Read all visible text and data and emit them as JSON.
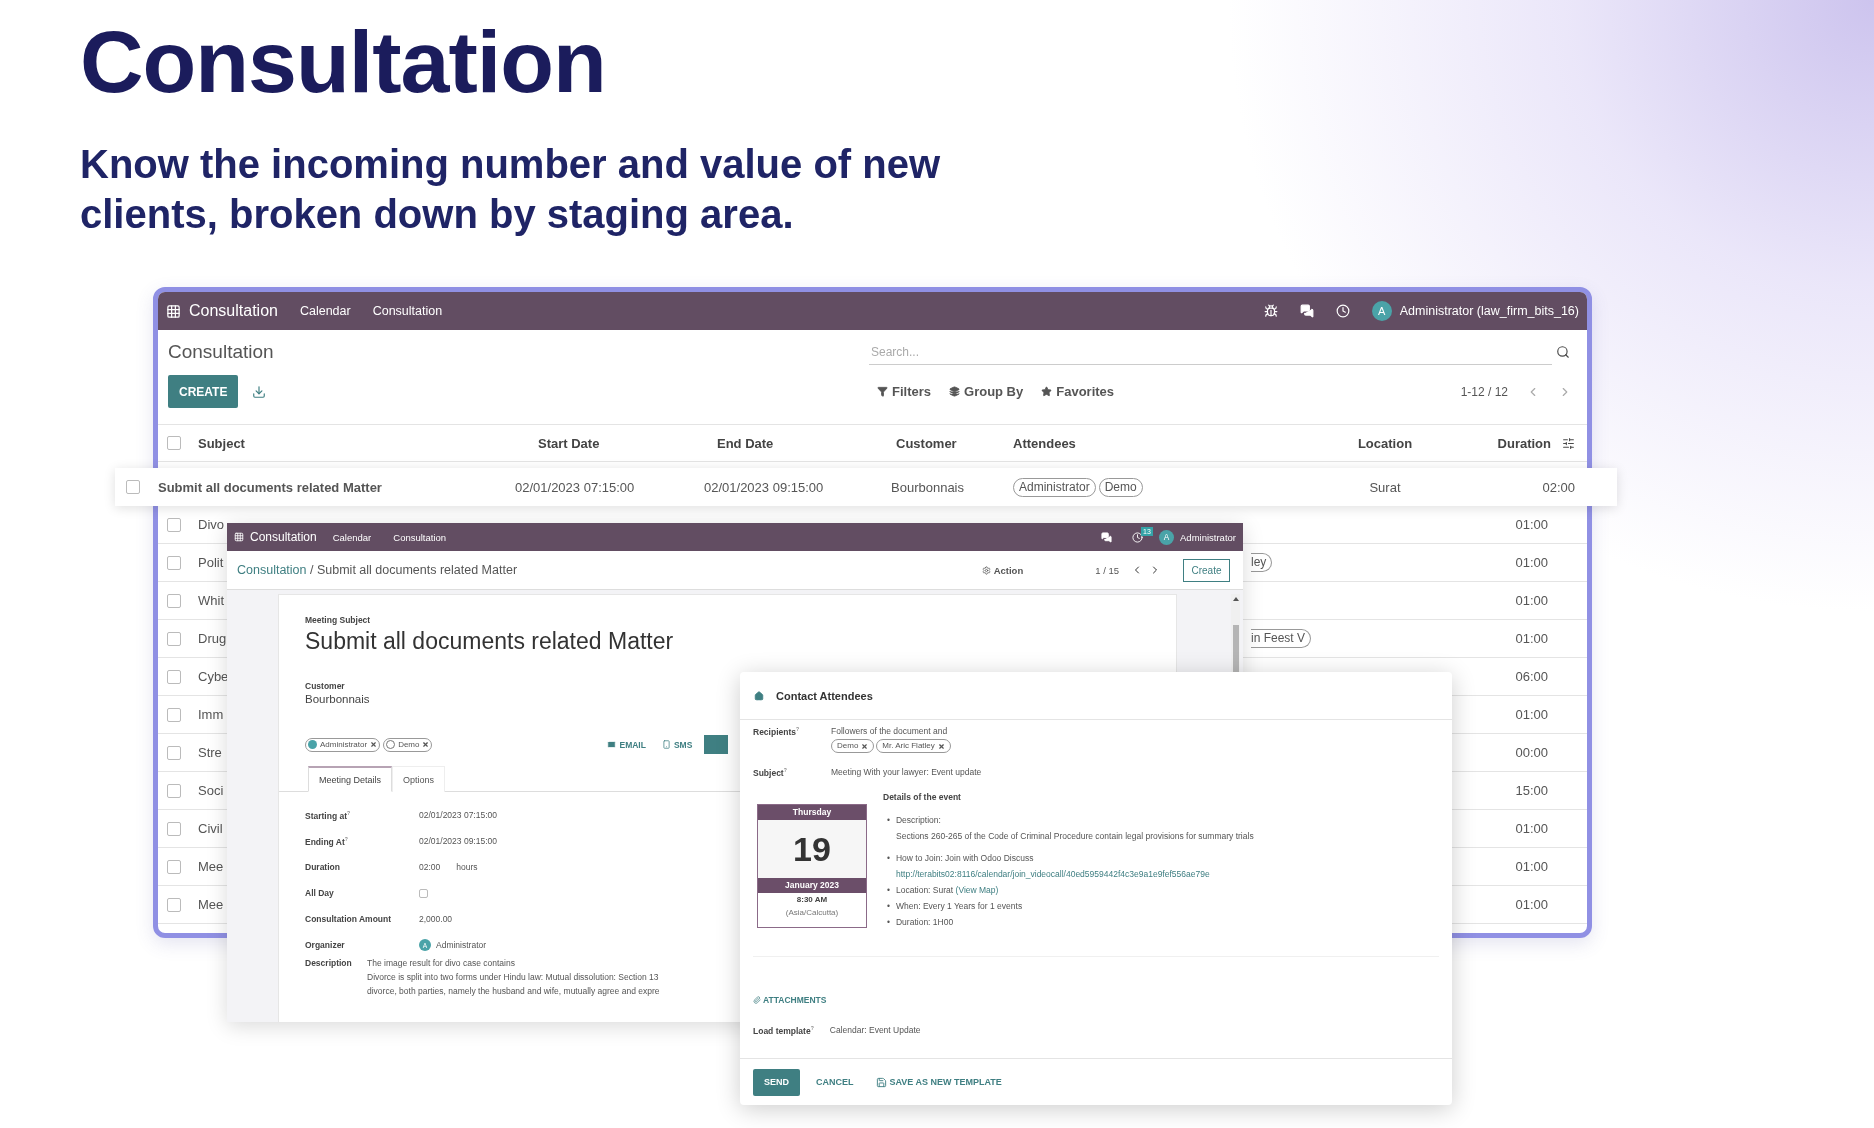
{
  "hero": {
    "title": "Consultation",
    "subtitle": "Know the incoming number and value of new clients, broken down by staging area."
  },
  "list_window": {
    "navbar": {
      "app": "Consultation",
      "menus": [
        "Calendar",
        "Consultation"
      ],
      "avatar": "A",
      "user": "Administrator (law_firm_bits_16)"
    },
    "title": "Consultation",
    "search": {
      "placeholder": "Search..."
    },
    "create": "CREATE",
    "filters": [
      {
        "kind": "filter",
        "label": "Filters"
      },
      {
        "kind": "group",
        "label": "Group By"
      },
      {
        "kind": "favorite",
        "label": "Favorites"
      }
    ],
    "pager": "1-12 / 12",
    "columns": [
      "Subject",
      "Start Date",
      "End Date",
      "Customer",
      "Attendees",
      "Location",
      "Duration"
    ],
    "select_all_checked": false,
    "highlighted_row": {
      "checked": false,
      "subject": "Submit all documents related Matter",
      "start": "02/01/2023 07:15:00",
      "end": "02/01/2023 09:15:00",
      "customer": "Bourbonnais",
      "attendees": [
        "Administrator",
        "Demo"
      ],
      "location": "Surat",
      "duration": "02:00"
    },
    "rows": [
      {
        "checked": false,
        "subject": "Divo",
        "duration": "01:00"
      },
      {
        "checked": false,
        "subject": "Polit",
        "attendee_fragment": "ley",
        "duration": "01:00"
      },
      {
        "checked": false,
        "subject": "Whit",
        "duration": "01:00"
      },
      {
        "checked": false,
        "subject": "Drug",
        "attendee_fragment": "in Feest V",
        "duration": "01:00"
      },
      {
        "checked": false,
        "subject": "Cybe",
        "duration": "06:00"
      },
      {
        "checked": false,
        "subject": "Imm",
        "duration": "01:00"
      },
      {
        "checked": false,
        "subject": "Stre",
        "duration": "00:00"
      },
      {
        "checked": false,
        "subject": "Soci",
        "duration": "15:00"
      },
      {
        "checked": false,
        "subject": "Civil",
        "duration": "01:00"
      },
      {
        "checked": false,
        "subject": "Mee",
        "duration": "01:00"
      },
      {
        "checked": false,
        "subject": "Mee",
        "duration": "01:00"
      }
    ]
  },
  "form_window": {
    "navbar": {
      "app": "Consultation",
      "menus": [
        "Calendar",
        "Consultation"
      ],
      "badge": "13",
      "avatar": "A",
      "user": "Administrator"
    },
    "breadcrumb": {
      "parent": "Consultation",
      "separator": "/",
      "current": "Submit all documents related Matter"
    },
    "action": "Action",
    "pager": "1 / 15",
    "create": "Create",
    "subject_label": "Meeting Subject",
    "subject": "Submit all documents related Matter",
    "customer_label": "Customer",
    "customer": "Bourbonnais",
    "attendees": [
      {
        "name": "Administrator",
        "kind": "user"
      },
      {
        "name": "Demo",
        "kind": "guest"
      }
    ],
    "actions": [
      {
        "kind": "email",
        "label": "EMAIL"
      },
      {
        "kind": "sms",
        "label": "SMS"
      }
    ],
    "tabs": [
      {
        "label": "Meeting Details",
        "selected": true
      },
      {
        "label": "Options",
        "selected": false
      }
    ],
    "fields": [
      {
        "kind": "text",
        "label": "Starting at$^{?}$",
        "value": "02/01/2023 07:15:00"
      },
      {
        "kind": "text",
        "label": "Ending At$^{?}$",
        "value": "02/01/2023 09:15:00"
      },
      {
        "kind": "duration",
        "label": "Duration",
        "value": "02:00",
        "unit": "hours"
      },
      {
        "kind": "checkbox",
        "label": "All Day",
        "checked": false
      },
      {
        "kind": "text",
        "label": "Consultation Amount",
        "value": "2,000.00"
      },
      {
        "kind": "user",
        "label": "Organizer",
        "avatar": "A",
        "value": "Administrator"
      },
      {
        "kind": "description",
        "label": "Description",
        "lines": [
          "The image result for divo case contains",
          "Divorce is split into two forms under Hindu law: Mutual dissolution: Section 13",
          "divorce, both parties, namely the husband and wife, mutually agree and expre"
        ]
      }
    ]
  },
  "dialog": {
    "title": "Contact Attendees",
    "recipients_label": "Recipients$^{?}$",
    "recipients_text": "Followers of the document and",
    "recipients": [
      "Demo",
      "Mr. Aric Flatley"
    ],
    "subject_label": "Subject$^{?}$",
    "subject": "Meeting With your lawyer: Event update",
    "details_title": "Details of the event",
    "calendar": {
      "weekday": "Thursday",
      "day": "19",
      "month": "January 2023",
      "time": "8:30 AM",
      "timezone": "(Asia/Calcutta)"
    },
    "details": [
      {
        "kind": "text",
        "marker": "•",
        "lines": [
          "Description:",
          "Sections 260-265 of the Code of Criminal Procedure contain legal provisions for summary trials"
        ]
      },
      {
        "kind": "url",
        "marker": "•",
        "text": "How to Join: Join with Odoo Discuss",
        "url": "http://terabits02:8116/calendar/join_videocall/40ed5959442f4c3e9a1e9fef556ae79e"
      },
      {
        "kind": "map",
        "marker": "•",
        "text": "Location: Surat",
        "link": "(View Map)"
      },
      {
        "kind": "text",
        "marker": "•",
        "lines": [
          "When: Every 1 Years for 1 events"
        ]
      },
      {
        "kind": "text",
        "marker": "•",
        "lines": [
          "Duration: 1H00"
        ]
      }
    ],
    "attachments": "ATTACHMENTS",
    "template_label": "Load template$^{?}$",
    "template": "Calendar: Event Update",
    "buttons": [
      {
        "kind": "primary",
        "label": "SEND"
      },
      {
        "kind": "link",
        "label": "CANCEL"
      },
      {
        "kind": "save",
        "label": "SAVE AS NEW TEMPLATE"
      }
    ]
  }
}
